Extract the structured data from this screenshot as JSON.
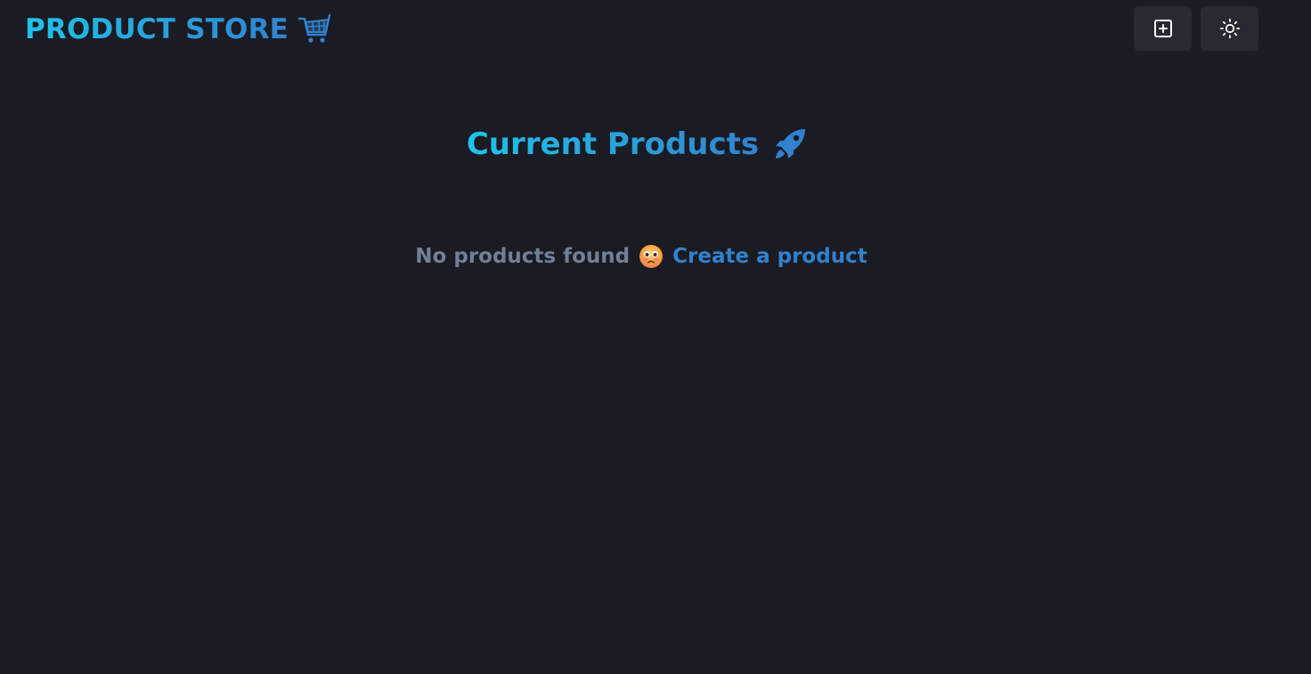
{
  "header": {
    "brand_label": "PRODUCT STORE",
    "brand_icon": "shopping-cart-icon",
    "add_button_icon": "plus-square-icon",
    "theme_button_icon": "sun-icon"
  },
  "main": {
    "title": "Current Products",
    "title_icon": "rocket-icon",
    "empty_message": "No products found",
    "empty_icon": "sad-face-emoji",
    "create_link_label": "Create a product"
  },
  "colors": {
    "background": "#1a1b23",
    "accent_start": "#1fc3ea",
    "accent_end": "#3182ce",
    "muted_text": "#718096",
    "button_bg": "#282a33"
  }
}
